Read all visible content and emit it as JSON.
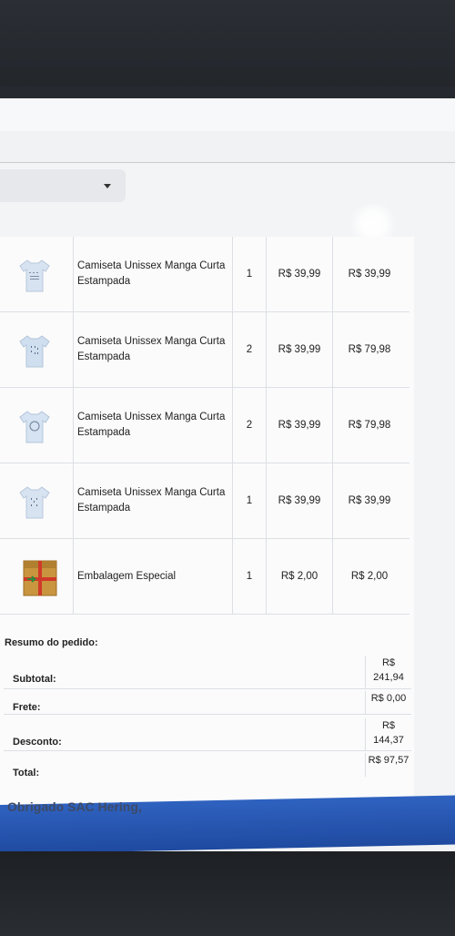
{
  "items": [
    {
      "name": "Camiseta Unissex Manga Curta Estampada",
      "qty": "1",
      "unit_price": "R$ 39,99",
      "total": "R$ 39,99",
      "image": "tshirt-icon"
    },
    {
      "name": "Camiseta Unissex Manga Curta Estampada",
      "qty": "2",
      "unit_price": "R$ 39,99",
      "total": "R$ 79,98",
      "image": "tshirt-icon"
    },
    {
      "name": "Camiseta Unissex Manga Curta Estampada",
      "qty": "2",
      "unit_price": "R$ 39,99",
      "total": "R$ 79,98",
      "image": "tshirt-icon"
    },
    {
      "name": "Camiseta Unissex Manga Curta Estampada",
      "qty": "1",
      "unit_price": "R$ 39,99",
      "total": "R$ 39,99",
      "image": "tshirt-icon"
    },
    {
      "name": "Embalagem Especial",
      "qty": "1",
      "unit_price": "R$ 2,00",
      "total": "R$ 2,00",
      "image": "gift-box-icon"
    }
  ],
  "summary": {
    "title": "Resumo do pedido:",
    "subtotal_label": "Subtotal:",
    "subtotal_value": "R$ 241,94",
    "frete_label": "Frete:",
    "frete_value": "R$ 0,00",
    "desconto_label": "Desconto:",
    "desconto_value": "R$ 144,37",
    "total_label": "Total:",
    "total_value": "R$ 97,57"
  },
  "footer": {
    "thanks": "Obrigado SAC Hering,"
  },
  "colors": {
    "footer_bar": "#2a5ab5",
    "thanks_text": "#3d4a66"
  }
}
